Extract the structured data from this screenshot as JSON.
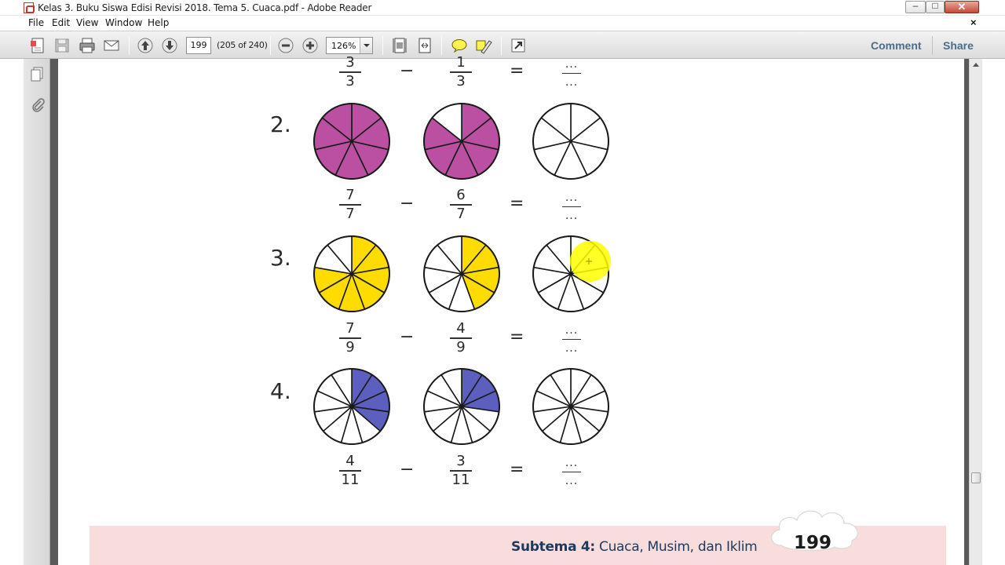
{
  "window": {
    "title": "Kelas 3. Buku Siswa Edisi Revisi 2018. Tema 5. Cuaca.pdf - Adobe Reader",
    "min_glyph": "–",
    "max_glyph": "□",
    "close_glyph": "✕"
  },
  "menu": {
    "items": [
      "File",
      "Edit",
      "View",
      "Window",
      "Help"
    ],
    "doc_close": "×"
  },
  "toolbar": {
    "page_input": "199",
    "page_count": "(205 of 240)",
    "zoom": "126%",
    "comment": "Comment",
    "share": "Share"
  },
  "worksheet": {
    "colors": {
      "magenta": "#bb4fa2",
      "yellow": "#ffdc00",
      "blue": "#5d5fbf"
    },
    "top_row": {
      "a_num": "3",
      "a_den": "3",
      "b_num": "1",
      "b_den": "3",
      "minus": "−",
      "equals": "=",
      "r_num": "...",
      "r_den": "..."
    },
    "problems": [
      {
        "label": "2.",
        "slices": 7,
        "a_filled": 7,
        "b_filled": 6,
        "color": "magenta",
        "a_num": "7",
        "a_den": "7",
        "b_num": "6",
        "b_den": "7",
        "minus": "−",
        "equals": "=",
        "r_num": "...",
        "r_den": "..."
      },
      {
        "label": "3.",
        "slices": 9,
        "a_filled": 7,
        "b_filled": 4,
        "color": "yellow",
        "a_num": "7",
        "a_den": "9",
        "b_num": "4",
        "b_den": "9",
        "minus": "−",
        "equals": "=",
        "r_num": "...",
        "r_den": "..."
      },
      {
        "label": "4.",
        "slices": 11,
        "a_filled": 4,
        "b_filled": 3,
        "color": "blue",
        "a_num": "4",
        "a_den": "11",
        "b_num": "3",
        "b_den": "11",
        "minus": "−",
        "equals": "=",
        "r_num": "...",
        "r_den": "..."
      }
    ]
  },
  "footer": {
    "subtema_bold": "Subtema 4:",
    "subtema_text": " Cuaca, Musim, dan Iklim",
    "page_number": "199"
  }
}
